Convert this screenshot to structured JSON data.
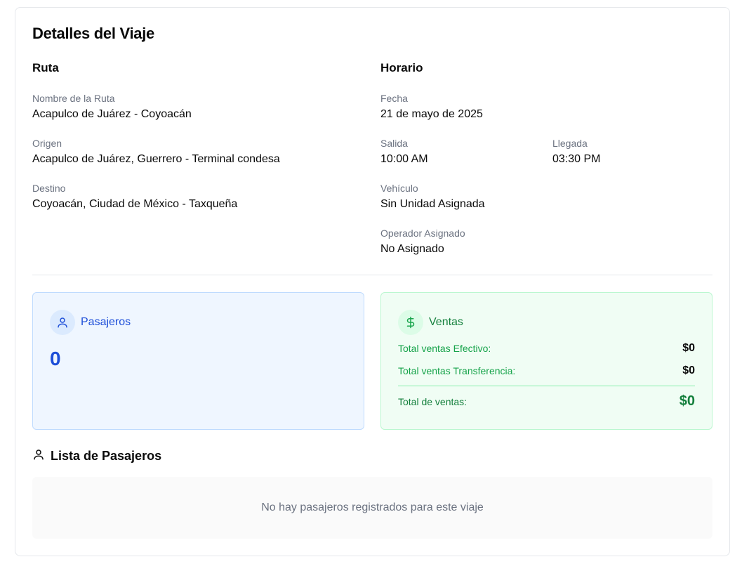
{
  "page_title": "Detalles del Viaje",
  "route": {
    "section_title": "Ruta",
    "name_label": "Nombre de la Ruta",
    "name_value": "Acapulco de Juárez - Coyoacán",
    "origin_label": "Origen",
    "origin_value": "Acapulco de Juárez, Guerrero - Terminal condesa",
    "destination_label": "Destino",
    "destination_value": "Coyoacán, Ciudad de México - Taxqueña"
  },
  "schedule": {
    "section_title": "Horario",
    "date_label": "Fecha",
    "date_value": "21 de mayo de 2025",
    "departure_label": "Salida",
    "departure_value": "10:00 AM",
    "arrival_label": "Llegada",
    "arrival_value": "03:30 PM",
    "vehicle_label": "Vehículo",
    "vehicle_value": "Sin Unidad Asignada",
    "operator_label": "Operador Asignado",
    "operator_value": "No Asignado"
  },
  "passengers": {
    "title": "Pasajeros",
    "count": "0",
    "icon": "user-icon"
  },
  "sales": {
    "title": "Ventas",
    "icon": "dollar-icon",
    "cash_label": "Total ventas Efectivo:",
    "cash_value": "$0",
    "transfer_label": "Total ventas Transferencia:",
    "transfer_value": "$0",
    "total_label": "Total de ventas:",
    "total_value": "$0"
  },
  "passenger_list": {
    "title": "Lista de Pasajeros",
    "icon": "user-icon",
    "empty_message": "No hay pasajeros registrados para este viaje"
  },
  "colors": {
    "blue_accent": "#1d4ed8",
    "green_accent": "#15803d",
    "muted_text": "#6b7280"
  }
}
